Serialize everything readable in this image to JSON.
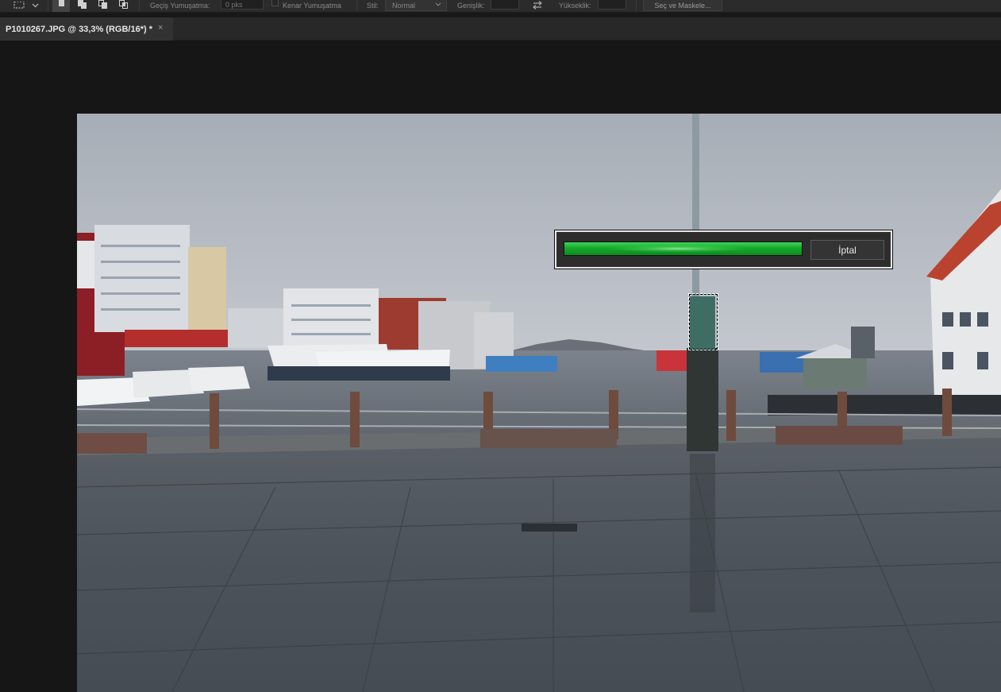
{
  "options_bar": {
    "feather_label": "Geçiş Yumuşatma:",
    "feather_value": "0 pks",
    "antialias_label": "Kenar Yumuşatma",
    "style_label": "Stil:",
    "style_value": "Normal",
    "width_label": "Genişlik:",
    "height_label": "Yükseklik:",
    "select_mask_label": "Seç ve Maskele..."
  },
  "document_tab": {
    "title": "P1010267.JPG @ 33,3% (RGB/16*) *",
    "close_glyph": "×"
  },
  "progress_dialog": {
    "progress_fraction": 1.0,
    "cancel_label": "İptal"
  },
  "colors": {
    "progress_green": "#16a82c",
    "panel_bg": "#2b2b2b",
    "canvas_bg": "#161616"
  },
  "icons": {
    "marquee_tool": "rect-marquee-icon",
    "swap": "swap-arrows-icon"
  }
}
